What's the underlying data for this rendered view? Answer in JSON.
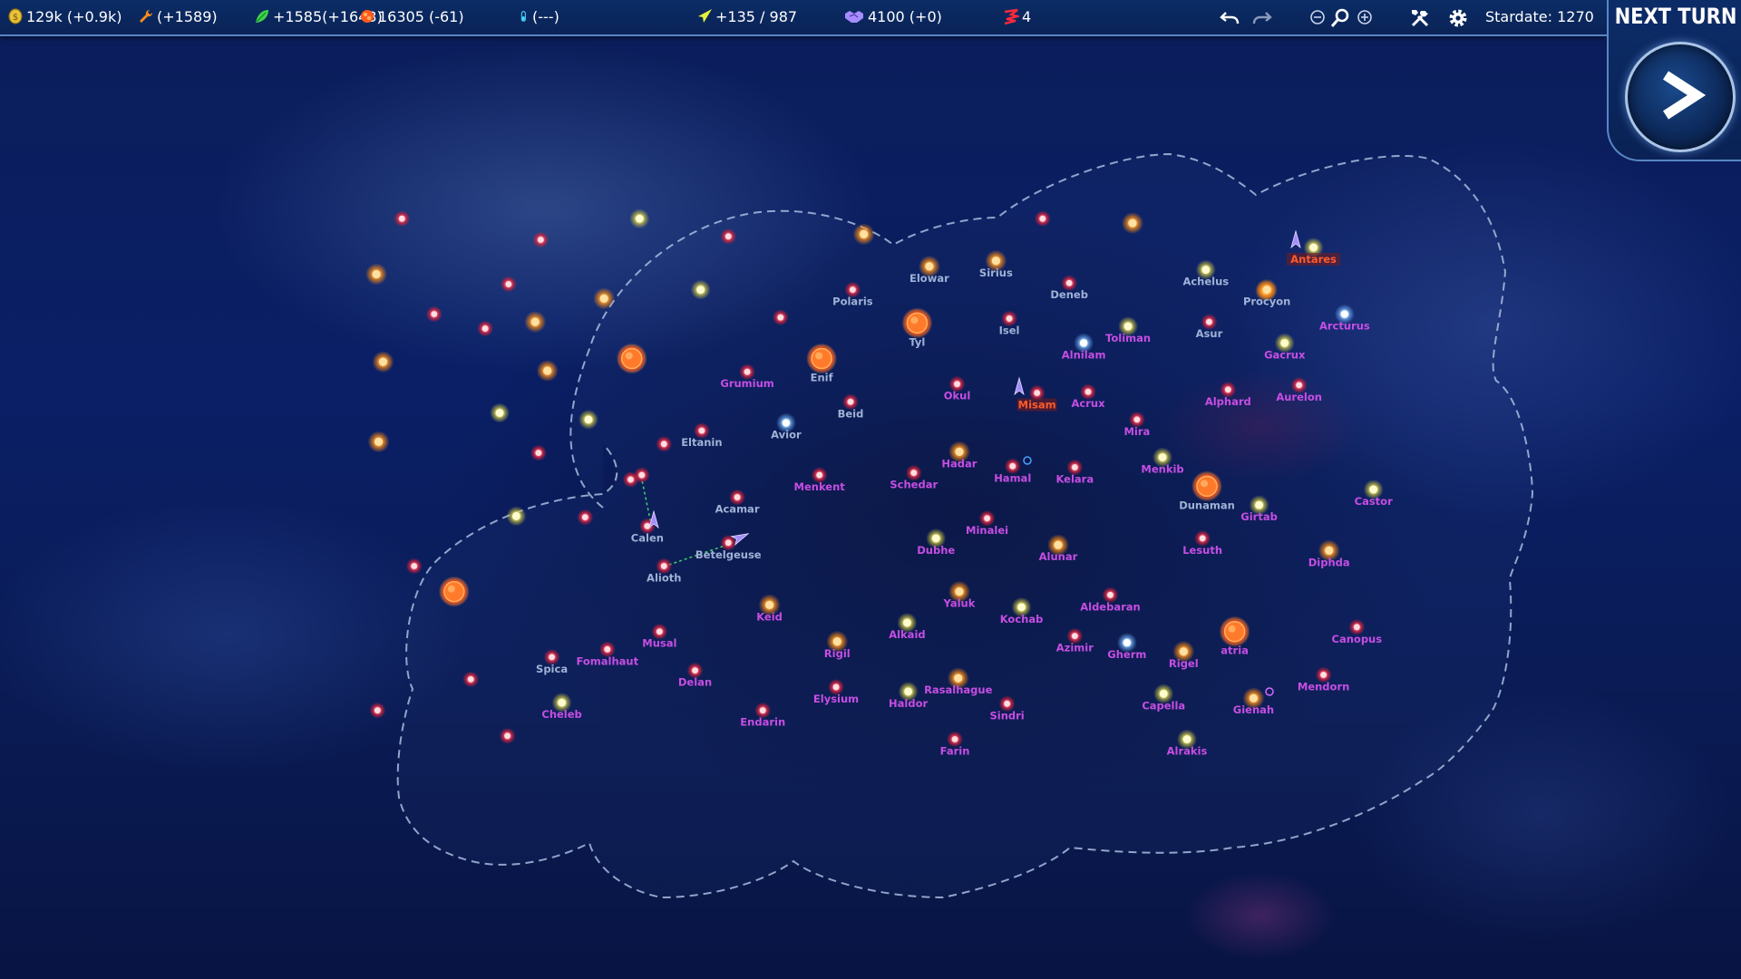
{
  "topbar": {
    "credits": "129k (+0.9k)",
    "industry": "(+1589)",
    "food": "+1585(+1643)",
    "population": "16305 (-61)",
    "research": "(---)",
    "command": "+135 / 987",
    "influence": "4100 (+0)",
    "fleets": "4",
    "stardate": "Stardate: 1270",
    "icons": {
      "credits": "coin-icon",
      "industry": "wrench-icon",
      "food": "leaf-icon",
      "population": "population-icon",
      "research": "test-tube-icon",
      "command": "ship-icon",
      "influence": "handshake-icon",
      "fleets": "fleet-icon",
      "undo": "undo-icon",
      "redo": "redo-icon",
      "zoom_out": "zoom-out-icon",
      "zoom": "magnifier-icon",
      "zoom_in": "zoom-in-icon",
      "tools": "tools-icon",
      "settings": "gear-icon"
    }
  },
  "next_turn": {
    "label": "NEXT TURN",
    "icon": "arrow-right-icon"
  },
  "colors": {
    "label_player": "#c64ee3",
    "label_neutral": "#9fb2d6",
    "label_enemy": "#ff5a2a",
    "border": "#a9bde0"
  },
  "systems": [
    {
      "name": "Antares",
      "type": "yellow",
      "owner": "enemy"
    },
    {
      "name": "Achelus",
      "type": "yellow",
      "owner": "neutral"
    },
    {
      "name": "Procyon",
      "type": "orange",
      "owner": "neutral"
    },
    {
      "name": "Arcturus",
      "type": "blue",
      "owner": "player"
    },
    {
      "name": "Asur",
      "type": "red",
      "owner": "neutral"
    },
    {
      "name": "Gacrux",
      "type": "yellow",
      "owner": "player"
    },
    {
      "name": "Aurelon",
      "type": "red",
      "owner": "player"
    },
    {
      "name": "Alphard",
      "type": "red",
      "owner": "player"
    },
    {
      "name": "Elowar",
      "type": "orange",
      "owner": "neutral"
    },
    {
      "name": "Sirius",
      "type": "orange",
      "owner": "neutral"
    },
    {
      "name": "Deneb",
      "type": "red",
      "owner": "neutral"
    },
    {
      "name": "Polaris",
      "type": "red",
      "owner": "neutral"
    },
    {
      "name": "Tyl",
      "type": "giant",
      "owner": "neutral"
    },
    {
      "name": "Isel",
      "type": "red",
      "owner": "neutral"
    },
    {
      "name": "Toliman",
      "type": "yellow",
      "owner": "player"
    },
    {
      "name": "Alnilam",
      "type": "blue",
      "owner": "player"
    },
    {
      "name": "Grumium",
      "type": "red",
      "owner": "player"
    },
    {
      "name": "Enif",
      "type": "giant",
      "owner": "neutral"
    },
    {
      "name": "Beid",
      "type": "red",
      "owner": "neutral"
    },
    {
      "name": "Okul",
      "type": "red",
      "owner": "player"
    },
    {
      "name": "Misam",
      "type": "red",
      "owner": "enemy"
    },
    {
      "name": "Acrux",
      "type": "red",
      "owner": "player"
    },
    {
      "name": "Mira",
      "type": "red",
      "owner": "player"
    },
    {
      "name": "Eltanin",
      "type": "red",
      "owner": "neutral"
    },
    {
      "name": "Avior",
      "type": "blue",
      "owner": "neutral"
    },
    {
      "name": "Menkent",
      "type": "red",
      "owner": "player"
    },
    {
      "name": "Schedar",
      "type": "red",
      "owner": "player"
    },
    {
      "name": "Hadar",
      "type": "orange",
      "owner": "player"
    },
    {
      "name": "Hamal",
      "type": "red",
      "owner": "player"
    },
    {
      "name": "Kelara",
      "type": "red",
      "owner": "player"
    },
    {
      "name": "Menkib",
      "type": "yellow",
      "owner": "player"
    },
    {
      "name": "Dunaman",
      "type": "giant",
      "owner": "neutral"
    },
    {
      "name": "Girtab",
      "type": "yellow",
      "owner": "player"
    },
    {
      "name": "Castor",
      "type": "yellow",
      "owner": "player"
    },
    {
      "name": "Acamar",
      "type": "red",
      "owner": "neutral"
    },
    {
      "name": "Calen",
      "type": "red",
      "owner": "neutral"
    },
    {
      "name": "Betelgeuse",
      "type": "red",
      "owner": "neutral"
    },
    {
      "name": "Alioth",
      "type": "red",
      "owner": "neutral"
    },
    {
      "name": "Minalei",
      "type": "red",
      "owner": "player"
    },
    {
      "name": "Dubhe",
      "type": "yellow",
      "owner": "player"
    },
    {
      "name": "Alunar",
      "type": "orange",
      "owner": "player"
    },
    {
      "name": "Lesuth",
      "type": "red",
      "owner": "player"
    },
    {
      "name": "Diphda",
      "type": "orange",
      "owner": "player"
    },
    {
      "name": "Keid",
      "type": "orange",
      "owner": "player"
    },
    {
      "name": "Yaluk",
      "type": "orange",
      "owner": "player"
    },
    {
      "name": "Kochab",
      "type": "yellow",
      "owner": "player"
    },
    {
      "name": "Aldebaran",
      "type": "red",
      "owner": "player"
    },
    {
      "name": "Alkaid",
      "type": "yellow",
      "owner": "player"
    },
    {
      "name": "Azimir",
      "type": "red",
      "owner": "player"
    },
    {
      "name": "Gherm",
      "type": "blue",
      "owner": "player"
    },
    {
      "name": "atria",
      "type": "giant",
      "owner": "player"
    },
    {
      "name": "Canopus",
      "type": "red",
      "owner": "player"
    },
    {
      "name": "Musal",
      "type": "red",
      "owner": "player"
    },
    {
      "name": "Fomalhaut",
      "type": "red",
      "owner": "player"
    },
    {
      "name": "Spica",
      "type": "red",
      "owner": "neutral"
    },
    {
      "name": "Rigil",
      "type": "orange",
      "owner": "player"
    },
    {
      "name": "Rigel",
      "type": "orange",
      "owner": "player"
    },
    {
      "name": "Delan",
      "type": "red",
      "owner": "player"
    },
    {
      "name": "Elysium",
      "type": "red",
      "owner": "player"
    },
    {
      "name": "Rasalhague",
      "type": "orange",
      "owner": "player"
    },
    {
      "name": "Haldor",
      "type": "yellow",
      "owner": "player"
    },
    {
      "name": "Sindri",
      "type": "red",
      "owner": "player"
    },
    {
      "name": "Capella",
      "type": "yellow",
      "owner": "player"
    },
    {
      "name": "Gienah",
      "type": "orange",
      "owner": "player"
    },
    {
      "name": "Mendorn",
      "type": "red",
      "owner": "player"
    },
    {
      "name": "Cheleb",
      "type": "yellow",
      "owner": "player"
    },
    {
      "name": "Endarin",
      "type": "red",
      "owner": "player"
    },
    {
      "name": "Farin",
      "type": "red",
      "owner": "player"
    },
    {
      "name": "Alrakis",
      "type": "yellow",
      "owner": "player"
    }
  ],
  "unnamed_systems": [
    {
      "type": "red"
    },
    {
      "type": "red"
    },
    {
      "type": "orange"
    },
    {
      "type": "red"
    },
    {
      "type": "red"
    },
    {
      "type": "red"
    },
    {
      "type": "orange"
    },
    {
      "type": "red"
    },
    {
      "type": "orange"
    },
    {
      "type": "orange"
    },
    {
      "type": "red"
    },
    {
      "type": "yellow"
    },
    {
      "type": "orange"
    },
    {
      "type": "yellow"
    },
    {
      "type": "yellow"
    },
    {
      "type": "orange"
    },
    {
      "type": "red"
    },
    {
      "type": "orange"
    },
    {
      "type": "red"
    },
    {
      "type": "orange"
    },
    {
      "type": "red"
    },
    {
      "type": "red"
    },
    {
      "type": "giant"
    },
    {
      "type": "red"
    },
    {
      "type": "red"
    },
    {
      "type": "red"
    },
    {
      "type": "red"
    },
    {
      "type": "giant"
    },
    {
      "type": "yellow"
    },
    {
      "type": "red"
    },
    {
      "type": "red"
    },
    {
      "type": "yellow"
    },
    {
      "type": "orange"
    }
  ]
}
